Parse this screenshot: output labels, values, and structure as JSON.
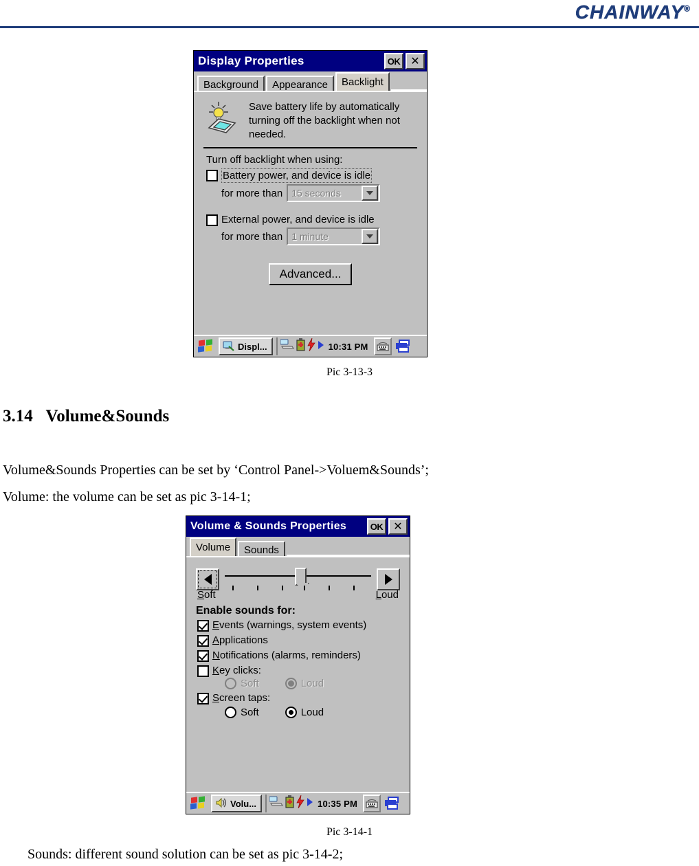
{
  "header": {
    "brand": "CHAINWAY",
    "registered": "®"
  },
  "dialog1": {
    "title": "Display Properties",
    "titlebar_buttons": {
      "ok": "OK",
      "close": "✕"
    },
    "tabs": [
      {
        "label": "Background",
        "active": false
      },
      {
        "label": "Appearance",
        "active": false
      },
      {
        "label": "Backlight",
        "active": true
      }
    ],
    "hint_icon": "backlight-device-icon",
    "hint_text": "Save battery life by automatically turning off the backlight when not needed.",
    "section_label": "Turn off backlight when using:",
    "options": [
      {
        "checkbox_label": "Battery power, and device is idle",
        "checked": false,
        "sub_label": "for more than",
        "combo_value": "15 seconds",
        "combo_disabled": true
      },
      {
        "checkbox_label": "External power, and device is idle",
        "checked": false,
        "sub_label": "for more than",
        "combo_value": "1 minute",
        "combo_disabled": true
      }
    ],
    "advanced_button": "Advanced...",
    "taskbar": {
      "start_icon": "windows-start-icon",
      "task_button_label": "Displ...",
      "task_button_icon": "display-properties-icon",
      "tray_icons": [
        "network-connection-icon",
        "battery-icon",
        "power-bolt-icon",
        "play-arrow-icon"
      ],
      "clock": "10:31 PM",
      "keyboard_icon": "keyboard-icon",
      "desktop_icon": "show-desktop-icon"
    }
  },
  "caption1": "Pic 3-13-3",
  "section": {
    "number": "3.14",
    "title": "Volume&Sounds",
    "para1": "Volume&Sounds Properties can be set by ‘Control Panel->Voluem&Sounds’;",
    "para2": "Volume: the volume can be set as pic 3-14-1;",
    "para3": "Sounds: different sound solution can be set as pic 3-14-2;"
  },
  "dialog2": {
    "title": "Volume & Sounds Properties",
    "titlebar_buttons": {
      "ok": "OK",
      "close": "✕"
    },
    "tabs": [
      {
        "label": "Volume",
        "active": true
      },
      {
        "label": "Sounds",
        "active": false
      }
    ],
    "volume": {
      "decrease_icon": "left-arrow-icon",
      "increase_icon": "right-arrow-icon",
      "min_label": "Soft",
      "max_label": "Loud",
      "slider_position_percent": 52,
      "tick_count": 6
    },
    "enable_label": "Enable sounds for:",
    "checkboxes": [
      {
        "label": "Events (warnings, system events)",
        "checked": true,
        "accel": "E"
      },
      {
        "label": "Applications",
        "checked": true,
        "accel": "A"
      },
      {
        "label": "Notifications (alarms, reminders)",
        "checked": true,
        "accel": "N"
      },
      {
        "label": "Key clicks:",
        "checked": false,
        "accel": "K"
      }
    ],
    "key_clicks_radios": {
      "disabled": true,
      "options": [
        {
          "label": "Soft",
          "selected": false
        },
        {
          "label": "Loud",
          "selected": true
        }
      ]
    },
    "screen_taps": {
      "label": "Screen taps:",
      "checked": true,
      "accel": "S"
    },
    "screen_taps_radios": {
      "disabled": false,
      "options": [
        {
          "label": "Soft",
          "selected": false
        },
        {
          "label": "Loud",
          "selected": true
        }
      ]
    },
    "taskbar": {
      "start_icon": "windows-start-icon",
      "task_button_label": "Volu...",
      "task_button_icon": "volume-sounds-icon",
      "tray_icons": [
        "network-connection-icon",
        "battery-icon",
        "power-bolt-icon",
        "play-arrow-icon"
      ],
      "clock": "10:35 PM",
      "keyboard_icon": "keyboard-icon",
      "desktop_icon": "show-desktop-icon"
    }
  },
  "caption2": "Pic 3-14-1"
}
